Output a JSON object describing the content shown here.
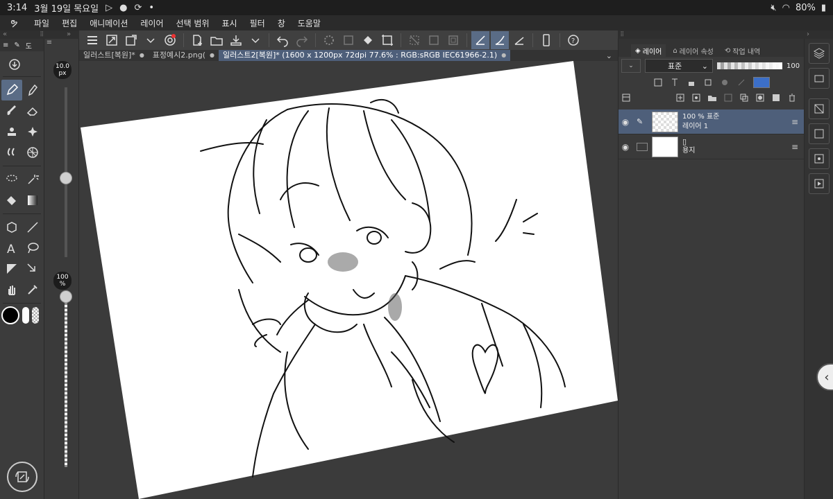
{
  "status_bar": {
    "time": "3:14",
    "date": "3월 19일 목요일",
    "dot": "•",
    "battery": "80%"
  },
  "menu": {
    "items": [
      "파일",
      "편집",
      "애니메이션",
      "레이어",
      "선택 범위",
      "표시",
      "필터",
      "창",
      "도움말"
    ]
  },
  "tool_palette": {
    "tab_label": "도"
  },
  "slider": {
    "brush_size": "10.0 px",
    "opacity": "100 %"
  },
  "tabs": [
    {
      "label": "일러스트[복원]*",
      "active": false
    },
    {
      "label": "표정예시2.png(",
      "active": false
    },
    {
      "label": "일러스트2[복원]* (1600 x 1200px 72dpi 77.6% : RGB:sRGB IEC61966-2.1)",
      "active": true
    }
  ],
  "layer_panel": {
    "tabs": [
      "레이어",
      "레이어 속성",
      "작업 내역"
    ],
    "blend_mode": "표준",
    "opacity": "100",
    "layers": [
      {
        "line1": "100 % 표준",
        "line2": "레이어 1",
        "selected": true
      },
      {
        "line1": "용지",
        "line2": "",
        "selected": false
      }
    ]
  },
  "colors": {
    "accent": "#5a6c86",
    "selected_tab": "#4e5f7a",
    "panel_bg": "#3a3a3a",
    "menu_bg": "#2b2b2b"
  }
}
